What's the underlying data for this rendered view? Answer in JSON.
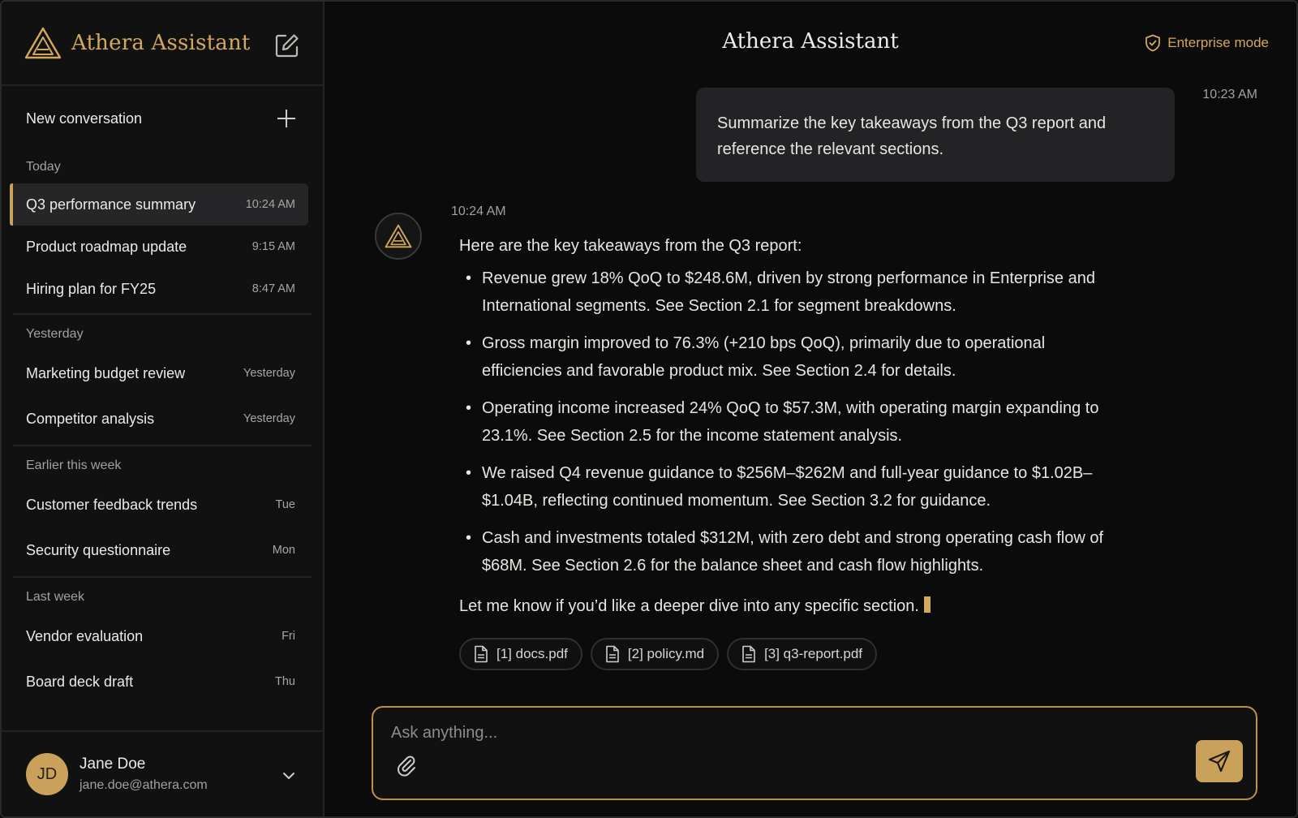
{
  "sidebar": {
    "brand": "Athera Assistant",
    "new_conversation": "New conversation",
    "groups": [
      {
        "label": "Today",
        "items": [
          {
            "title": "Q3 performance summary",
            "time": "10:24 AM",
            "active": true
          },
          {
            "title": "Product roadmap update",
            "time": "9:15 AM"
          },
          {
            "title": "Hiring plan for FY25",
            "time": "8:47 AM"
          }
        ]
      },
      {
        "label": "Yesterday",
        "items": [
          {
            "title": "Marketing budget review",
            "time": "Yesterday"
          },
          {
            "title": "Competitor analysis",
            "time": "Yesterday"
          }
        ]
      },
      {
        "label": "Earlier this week",
        "items": [
          {
            "title": "Customer feedback trends",
            "time": "Tue"
          },
          {
            "title": "Security questionnaire",
            "time": "Mon"
          }
        ]
      },
      {
        "label": "Last week",
        "items": [
          {
            "title": "Vendor evaluation",
            "time": "Fri"
          },
          {
            "title": "Board deck draft",
            "time": "Thu"
          }
        ]
      }
    ],
    "user": {
      "initials": "JD",
      "name": "Jane Doe",
      "email": "jane.doe@athera.com"
    }
  },
  "header": {
    "title": "Athera Assistant",
    "mode": "Enterprise mode"
  },
  "conversation": {
    "user_message": {
      "text": "Summarize the key takeaways from the Q3 report and reference the relevant sections.",
      "time": "10:23 AM"
    },
    "assistant_message": {
      "time": "10:24 AM",
      "intro": "Here are the key takeaways from the Q3 report:",
      "bullets": [
        "Revenue grew 18% QoQ to $248.6M, driven by strong performance in Enterprise and International segments. See Section 2.1 for segment breakdowns.",
        "Gross margin improved to 76.3% (+210 bps QoQ), primarily due to operational efficiencies and favorable product mix. See Section 2.4 for details.",
        "Operating income increased 24% QoQ to $57.3M, with operating margin expanding to 23.1%. See Section 2.5 for the income statement analysis.",
        "We raised Q4 revenue guidance to $256M–$262M and full-year guidance to $1.02B–$1.04B, reflecting continued momentum. See Section 3.2 for guidance.",
        "Cash and investments totaled $312M, with zero debt and strong operating cash flow of $68M. See Section 2.6 for the balance sheet and cash flow highlights."
      ],
      "outro": "Let me know if you’d like a deeper dive into any specific section.",
      "sources": [
        "[1] docs.pdf",
        "[2] policy.md",
        "[3] q3-report.pdf"
      ]
    }
  },
  "composer": {
    "placeholder": "Ask anything..."
  },
  "colors": {
    "accent": "#c9a15a",
    "background": "#0b0b0c",
    "sidebar": "#111112"
  }
}
